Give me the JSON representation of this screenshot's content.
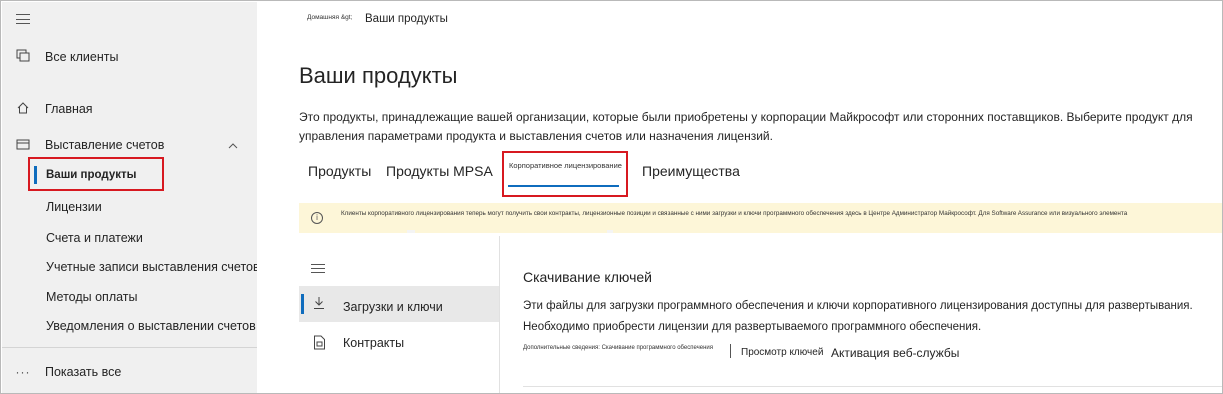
{
  "sidebar": {
    "all_clients": "Все клиенты",
    "home": "Главная",
    "billing": "Выставление счетов",
    "billing_items": [
      "Ваши продукты",
      "Лицензии",
      "Счета и платежи",
      "Учетные записи выставления счетов",
      "Методы оплаты",
      "Уведомления о выставлении счетов"
    ],
    "show_all": "Показать все"
  },
  "breadcrumb": {
    "home": "Домашняя &gt;",
    "current": "Ваши продукты"
  },
  "page": {
    "title": "Ваши продукты",
    "description": "Это продукты, принадлежащие вашей организации, которые были приобретены у корпорации Майкрософт или сторонних поставщиков. Выберите продукт для управления параметрами продукта и выставления счетов или назначения лицензий."
  },
  "tabs": {
    "products": "Продукты",
    "mpsa": "Продукты MPSA",
    "volume": "Корпоративное лицензирование",
    "benefits": "Преимущества"
  },
  "banner": {
    "text": "Клиенты корпоративного лицензирования теперь могут получить свои контракты, лицензионные позиции и связанные с ними загрузки и ключи программного обеспечения здесь в Центре Администратор Майкрософт. Для Software Assurance или визуального элемента"
  },
  "panel": {
    "downloads": "Загрузки и ключи",
    "contracts": "Контракты"
  },
  "content": {
    "title": "Скачивание ключей",
    "description": "Эти файлы для загрузки программного обеспечения и ключи корпоративного лицензирования доступны для развертывания. Необходимо приобрести лицензии для развертываемого программного обеспечения.",
    "more_info": "Дополнительные сведения: Скачивание программного обеспечения",
    "view_keys": "Просмотр ключей",
    "activate": "Активация веб-службы"
  },
  "colors": {
    "accent": "#0f6cbd",
    "highlight": "#d71920",
    "banner_bg": "#fdf6d8",
    "sidebar_bg": "#f0f0f0"
  }
}
